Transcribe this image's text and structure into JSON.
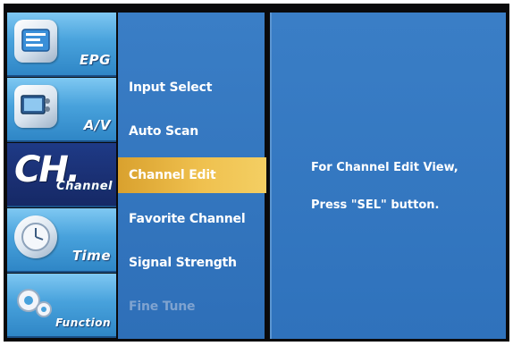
{
  "tabs": [
    {
      "label": "EPG",
      "icon": "epg-icon"
    },
    {
      "label": "A/V",
      "icon": "av-icon"
    },
    {
      "label": "Channel",
      "glyph": "CH.",
      "icon": "channel-icon"
    },
    {
      "label": "Time",
      "icon": "clock-icon"
    },
    {
      "label": "Function",
      "icon": "gears-icon"
    }
  ],
  "active_tab": "Channel",
  "menu": {
    "items": [
      {
        "label": "Input Select"
      },
      {
        "label": "Auto Scan"
      },
      {
        "label": "Channel Edit"
      },
      {
        "label": "Favorite Channel"
      },
      {
        "label": "Signal Strength"
      },
      {
        "label": "Fine Tune"
      }
    ],
    "selected": "Channel Edit",
    "disabled": "Fine Tune"
  },
  "info": {
    "line1": "For Channel Edit View,",
    "line2": "Press \"SEL\" button."
  },
  "colors": {
    "panel_blue": "#3a7ec6",
    "active_tab": "#1a2f72",
    "highlight_gold": "#efc04e",
    "disabled_text": "#7fa3d0"
  }
}
